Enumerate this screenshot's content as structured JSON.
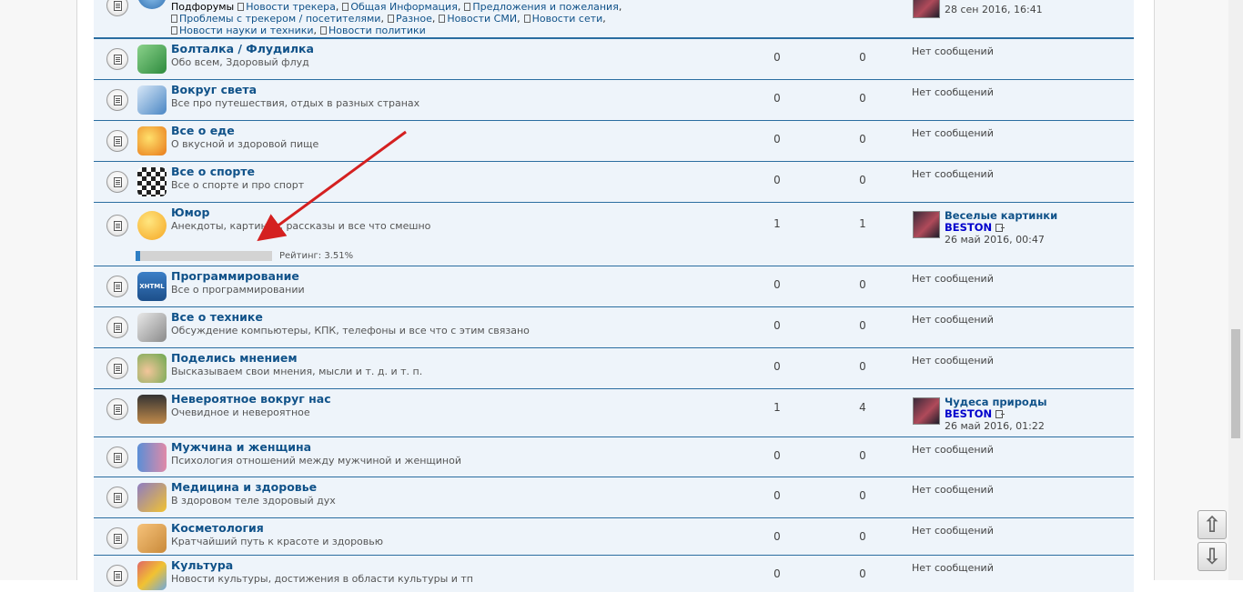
{
  "top_row": {
    "subforums_label": "Подфорумы",
    "subforums": [
      "Новости трекера",
      "Общая Информация",
      "Предложения и пожелания",
      "Проблемы с трекером / посетителями",
      "Разное",
      "Новости СМИ",
      "Новости сети",
      "Новости науки и техники",
      "Новости политики"
    ],
    "last_date": "28 сен 2016, 16:41"
  },
  "no_messages": "Нет сообщений",
  "forums": [
    {
      "title": "Болталка / Флудилка",
      "desc": "Обо всем, Здоровый флуд",
      "topics": "0",
      "posts": "0",
      "icon": "money-icon"
    },
    {
      "title": "Вокруг света",
      "desc": "Все про путешествия, отдых в разных странах",
      "topics": "0",
      "posts": "0",
      "icon": "travel-icon"
    },
    {
      "title": "Все о еде",
      "desc": "О вкусной и здоровой пище",
      "topics": "0",
      "posts": "0",
      "icon": "fish-icon"
    },
    {
      "title": "Все о спорте",
      "desc": "Все о спорте и про спорт",
      "topics": "0",
      "posts": "0",
      "icon": "checkered-flag-icon"
    },
    {
      "title": "Юмор",
      "desc": "Анекдоты, картинки, рассказы и все что смешно",
      "topics": "1",
      "posts": "1",
      "icon": "smiley-icon",
      "last": {
        "title": "Веселые картинки",
        "user": "BESTON",
        "date": "26 май 2016, 00:47"
      },
      "rating_label": "Рейтинг: 3.51%",
      "rating_percent": 3.51
    },
    {
      "title": "Программирование",
      "desc": "Все о программировании",
      "topics": "0",
      "posts": "0",
      "icon": "xhtml-icon",
      "icon_text": "XHTML"
    },
    {
      "title": "Все о технике",
      "desc": "Обсуждение компьютеры, КПК, телефоны и все что с этим связано",
      "topics": "0",
      "posts": "0",
      "icon": "computer-icon"
    },
    {
      "title": "Поделись мнением",
      "desc": "Высказываем свои мнения, мысли и т. д. и т. п.",
      "topics": "0",
      "posts": "0",
      "icon": "chat-user-icon"
    },
    {
      "title": "Невероятное вокруг нас",
      "desc": "Очевидное и невероятное",
      "topics": "1",
      "posts": "4",
      "icon": "magician-icon",
      "last": {
        "title": "Чудеса природы",
        "user": "BESTON",
        "date": "26 май 2016, 01:22"
      }
    },
    {
      "title": "Мужчина и женщина",
      "desc": "Психология отношений между мужчиной и женщиной",
      "topics": "0",
      "posts": "0",
      "icon": "couple-icon"
    },
    {
      "title": "Медицина и здоровье",
      "desc": "В здоровом теле здоровый дух",
      "topics": "0",
      "posts": "0",
      "icon": "shapes-icon"
    },
    {
      "title": "Косметология",
      "desc": "Кратчайший путь к красоте и здоровью",
      "topics": "0",
      "posts": "0",
      "icon": "handshake-icon"
    },
    {
      "title": "Культура",
      "desc": "Новости культуры, достижения в области культуры и тп",
      "topics": "0",
      "posts": "0",
      "icon": "art-icon"
    }
  ],
  "nav": {
    "up": "⇧",
    "down": "⇩"
  },
  "colors": {
    "link": "#105289",
    "user": "#0000cc",
    "row_bg": "#eef4fa",
    "border": "#2a6da0",
    "arrow": "#d42020"
  }
}
